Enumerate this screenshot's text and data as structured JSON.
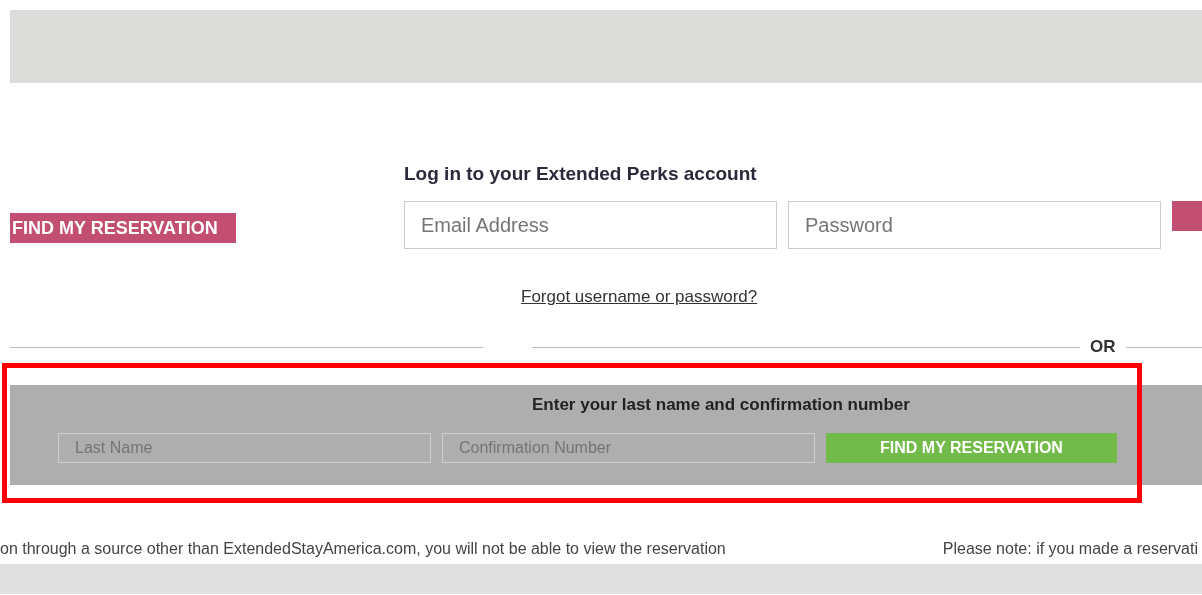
{
  "login": {
    "heading": "Log in to your Extended Perks account",
    "email": {
      "placeholder": "Email Address"
    },
    "password": {
      "placeholder": "Password"
    },
    "forgot_link": "Forgot username or password?"
  },
  "side_button": "FIND MY RESERVATION",
  "divider_label": "OR",
  "lookup": {
    "heading": "Enter your last name and confirmation number",
    "last_name": {
      "placeholder": "Last Name"
    },
    "confirmation": {
      "placeholder": "Confirmation Number"
    },
    "button": "FIND MY RESERVATION",
    "highlighted": true
  },
  "note": {
    "left": "on through a source other than ExtendedStayAmerica.com, you will not be able to view the reservation",
    "right": "Please note: if you made a reservati"
  }
}
